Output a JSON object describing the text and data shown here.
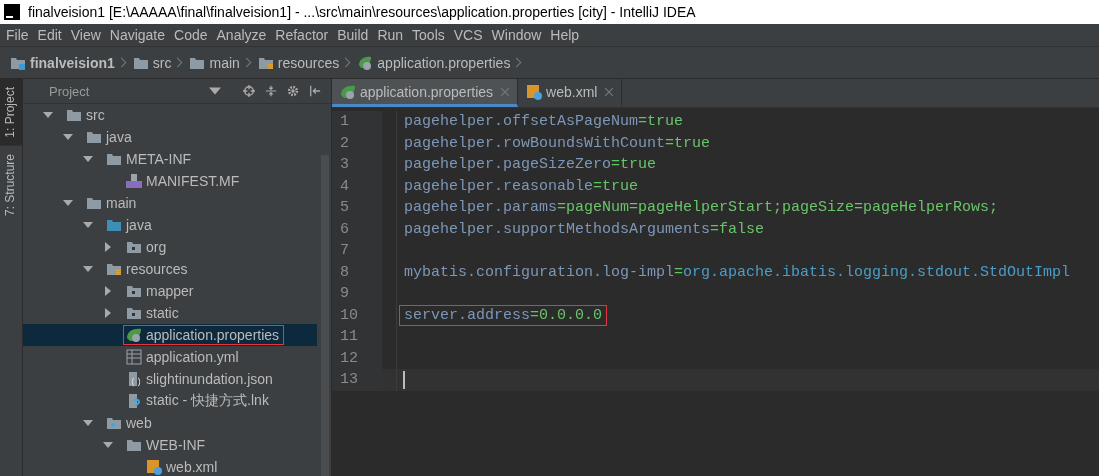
{
  "window": {
    "title": "finalveision1 [E:\\AAAAA\\final\\finalveision1] - ...\\src\\main\\resources\\application.properties [city] - IntelliJ IDEA"
  },
  "menu": [
    "File",
    "Edit",
    "View",
    "Navigate",
    "Code",
    "Analyze",
    "Refactor",
    "Build",
    "Run",
    "Tools",
    "VCS",
    "Window",
    "Help"
  ],
  "breadcrumb": [
    {
      "label": "finalveision1",
      "kind": "module"
    },
    {
      "label": "src",
      "kind": "folder"
    },
    {
      "label": "main",
      "kind": "folder"
    },
    {
      "label": "resources",
      "kind": "resources"
    },
    {
      "label": "application.properties",
      "kind": "spring"
    }
  ],
  "side_tabs": [
    {
      "label": "1: Project",
      "selected": true
    },
    {
      "label": "7: Structure",
      "selected": false
    }
  ],
  "project_panel": {
    "title": "Project",
    "tree": [
      {
        "label": "src",
        "kind": "folder",
        "expanded": true,
        "children": [
          {
            "label": "java",
            "kind": "folder",
            "expanded": true,
            "children": [
              {
                "label": "META-INF",
                "kind": "folder",
                "expanded": true,
                "children": [
                  {
                    "label": "MANIFEST.MF",
                    "kind": "manifest"
                  }
                ]
              }
            ]
          },
          {
            "label": "main",
            "kind": "folder",
            "expanded": true,
            "children": [
              {
                "label": "java",
                "kind": "source",
                "expanded": true,
                "children": [
                  {
                    "label": "org",
                    "kind": "package",
                    "expanded": false
                  }
                ]
              },
              {
                "label": "resources",
                "kind": "resources",
                "expanded": true,
                "children": [
                  {
                    "label": "mapper",
                    "kind": "package",
                    "expanded": false
                  },
                  {
                    "label": "static",
                    "kind": "package",
                    "expanded": false
                  },
                  {
                    "label": "application.properties",
                    "kind": "spring",
                    "selected": true
                  },
                  {
                    "label": "application.yml",
                    "kind": "yml",
                    "selected": false
                  },
                  {
                    "label": "slightinundation.json",
                    "kind": "json",
                    "selected": false
                  },
                  {
                    "label": "static - 快捷方式.lnk",
                    "kind": "unknown",
                    "selected": false
                  }
                ]
              },
              {
                "label": "web",
                "kind": "web",
                "expanded": true,
                "children": [
                  {
                    "label": "WEB-INF",
                    "kind": "folder",
                    "expanded": true,
                    "children": [
                      {
                        "label": "web.xml",
                        "kind": "xml",
                        "selected": false
                      }
                    ]
                  }
                ]
              }
            ]
          }
        ]
      }
    ]
  },
  "editor_tabs": [
    {
      "label": "application.properties",
      "kind": "spring",
      "selected": true
    },
    {
      "label": "web.xml",
      "kind": "xml",
      "selected": false
    }
  ],
  "editor_lines": [
    {
      "number": "1",
      "parts": [
        {
          "text": "pagehelper.offsetAsPageNum",
          "kind": "key"
        },
        {
          "text": "=",
          "kind": "sep"
        },
        {
          "text": "true",
          "kind": "value"
        }
      ]
    },
    {
      "number": "2",
      "parts": [
        {
          "text": "pagehelper.rowBoundsWithCount",
          "kind": "key"
        },
        {
          "text": "=",
          "kind": "sep"
        },
        {
          "text": "true",
          "kind": "value"
        }
      ]
    },
    {
      "number": "3",
      "parts": [
        {
          "text": "pagehelper.pageSizeZero",
          "kind": "key"
        },
        {
          "text": "=",
          "kind": "sep"
        },
        {
          "text": "true",
          "kind": "value"
        }
      ]
    },
    {
      "number": "4",
      "parts": [
        {
          "text": "pagehelper.reasonable",
          "kind": "key"
        },
        {
          "text": "=",
          "kind": "sep"
        },
        {
          "text": "true",
          "kind": "value"
        }
      ]
    },
    {
      "number": "5",
      "parts": [
        {
          "text": "pagehelper.params",
          "kind": "key"
        },
        {
          "text": "=",
          "kind": "sep"
        },
        {
          "text": "pageNum=pageHelperStart;pageSize=pageHelperRows;",
          "kind": "value"
        }
      ]
    },
    {
      "number": "6",
      "parts": [
        {
          "text": "pagehelper.supportMethodsArguments",
          "kind": "key"
        },
        {
          "text": "=",
          "kind": "sep"
        },
        {
          "text": "false",
          "kind": "value"
        }
      ]
    },
    {
      "number": "7"
    },
    {
      "number": "8",
      "parts": [
        {
          "text": "mybatis.configuration.log-impl",
          "kind": "key"
        },
        {
          "text": "=",
          "kind": "sep"
        },
        {
          "text": "org.apache.ibatis.logging.stdout.StdOutImpl",
          "kind": "ref"
        }
      ]
    },
    {
      "number": "9"
    },
    {
      "number": "10",
      "boxed": true,
      "parts": [
        {
          "text": "server.address",
          "kind": "key"
        },
        {
          "text": "=",
          "kind": "sep"
        },
        {
          "text": "0.0.0.0",
          "kind": "value"
        }
      ]
    },
    {
      "number": "11"
    },
    {
      "number": "12"
    },
    {
      "number": "13",
      "current": true
    }
  ]
}
